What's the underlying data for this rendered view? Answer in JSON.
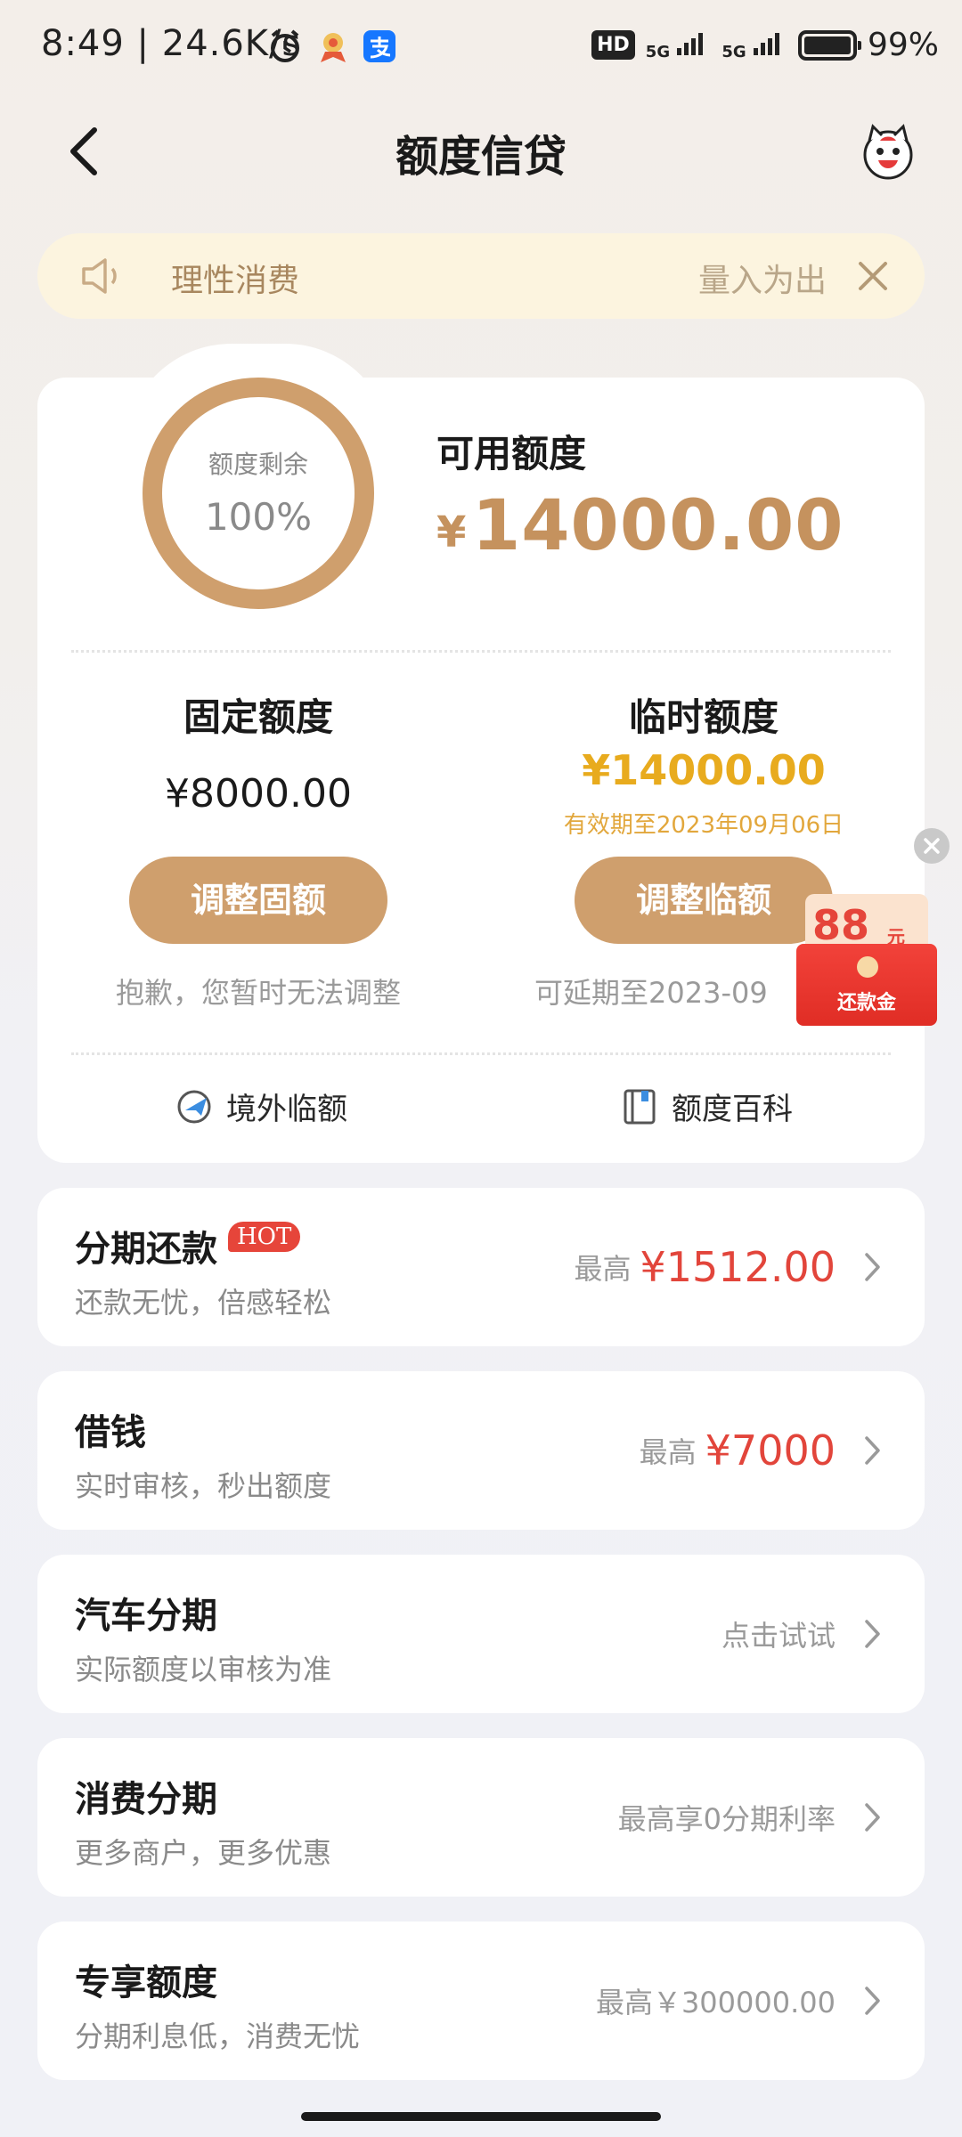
{
  "status_bar": {
    "time": "8:49",
    "speed": "| 24.6K/s",
    "hd": "HD",
    "net1": "5G",
    "net2": "5G",
    "battery": "99%"
  },
  "header": {
    "title": "额度信贷",
    "back_icon": "back-arrow-icon",
    "mascot_icon": "mascot-icon"
  },
  "notice": {
    "text": "理性消费",
    "text_right": "量入为出"
  },
  "quota": {
    "ring_label": "额度剩余",
    "ring_value": "100%",
    "ring_remaining_fraction": 1.0,
    "available_label": "可用额度",
    "currency": "¥",
    "available_amount": "14000.00"
  },
  "fixed": {
    "title": "固定额度",
    "amount": "¥8000.00",
    "button": "调整固额",
    "note": "抱歉，您暂时无法调整"
  },
  "temp": {
    "title": "临时额度",
    "amount": "¥14000.00",
    "valid": "有效期至2023年09月06日",
    "button": "调整临额",
    "note": "可延期至2023-09"
  },
  "links": {
    "overseas": "境外临额",
    "wiki": "额度百科"
  },
  "red_packet": {
    "amount": "88",
    "unit": "元",
    "label": "还款金"
  },
  "list": [
    {
      "title": "分期还款",
      "badge": "HOT",
      "sub": "还款无忧，倍感轻松",
      "prefix": "最高",
      "amount": "¥1512.00"
    },
    {
      "title": "借钱",
      "sub": "实时审核，秒出额度",
      "prefix": "最高",
      "amount": "¥7000"
    },
    {
      "title": "汽车分期",
      "sub": "实际额度以审核为准",
      "hint": "点击试试"
    },
    {
      "title": "消费分期",
      "sub": "更多商户，更多优惠",
      "hint": "最高享0分期利率"
    },
    {
      "title": "专享额度",
      "sub": "分期利息低，消费无忧",
      "hint": "最高￥300000.00"
    }
  ],
  "colors": {
    "accent_gold": "#cf9f6d",
    "amount_gold": "#c5925e",
    "temp_yellow": "#e8ab1e",
    "red": "#e2453b"
  }
}
